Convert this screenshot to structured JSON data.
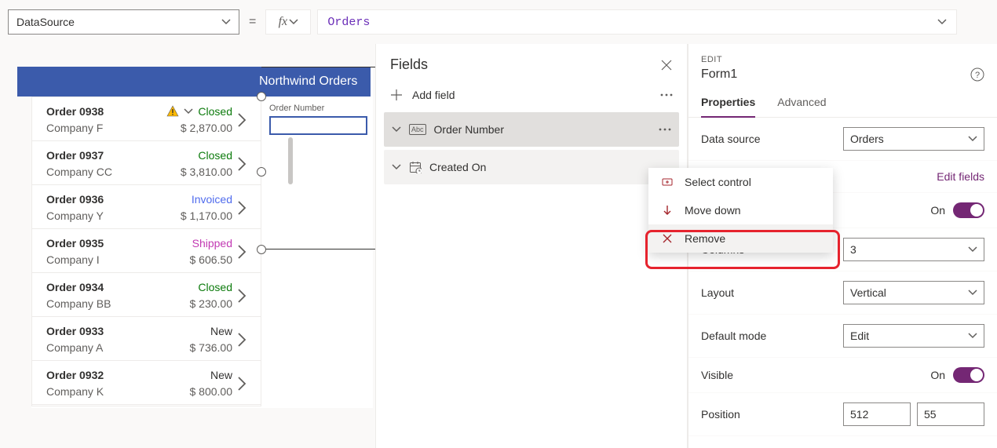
{
  "formula": {
    "property": "DataSource",
    "value": "Orders"
  },
  "canvas": {
    "header": "Northwind Orders",
    "datacard_label": "Order Number",
    "rows": [
      {
        "title": "Order 0938",
        "company": "Company F",
        "status": "Closed",
        "status_class": "st-closed",
        "price": "$ 2,870.00",
        "warn": true
      },
      {
        "title": "Order 0937",
        "company": "Company CC",
        "status": "Closed",
        "status_class": "st-closed",
        "price": "$ 3,810.00",
        "warn": false
      },
      {
        "title": "Order 0936",
        "company": "Company Y",
        "status": "Invoiced",
        "status_class": "st-invoiced",
        "price": "$ 1,170.00",
        "warn": false
      },
      {
        "title": "Order 0935",
        "company": "Company I",
        "status": "Shipped",
        "status_class": "st-shipped",
        "price": "$ 606.50",
        "warn": false
      },
      {
        "title": "Order 0934",
        "company": "Company BB",
        "status": "Closed",
        "status_class": "st-closed",
        "price": "$ 230.00",
        "warn": false
      },
      {
        "title": "Order 0933",
        "company": "Company A",
        "status": "New",
        "status_class": "st-new",
        "price": "$ 736.00",
        "warn": false
      },
      {
        "title": "Order 0932",
        "company": "Company K",
        "status": "New",
        "status_class": "st-new",
        "price": "$ 800.00",
        "warn": false
      }
    ]
  },
  "fields": {
    "title": "Fields",
    "add_label": "Add field",
    "items": [
      {
        "label": "Order Number",
        "icon": "abc"
      },
      {
        "label": "Created On",
        "icon": "calendar"
      }
    ]
  },
  "context_menu": {
    "select_control": "Select control",
    "move_down": "Move down",
    "remove": "Remove"
  },
  "props": {
    "section": "EDIT",
    "name": "Form1",
    "tabs": {
      "properties": "Properties",
      "advanced": "Advanced"
    },
    "labels": {
      "data_source": "Data source",
      "edit_fields": "Edit fields",
      "snap": "On",
      "columns": "Columns",
      "layout": "Layout",
      "default_mode": "Default mode",
      "visible": "Visible",
      "visible_on": "On",
      "position": "Position"
    },
    "values": {
      "data_source": "Orders",
      "columns": "3",
      "layout": "Vertical",
      "default_mode": "Edit",
      "pos_x": "512",
      "pos_y": "55"
    }
  }
}
